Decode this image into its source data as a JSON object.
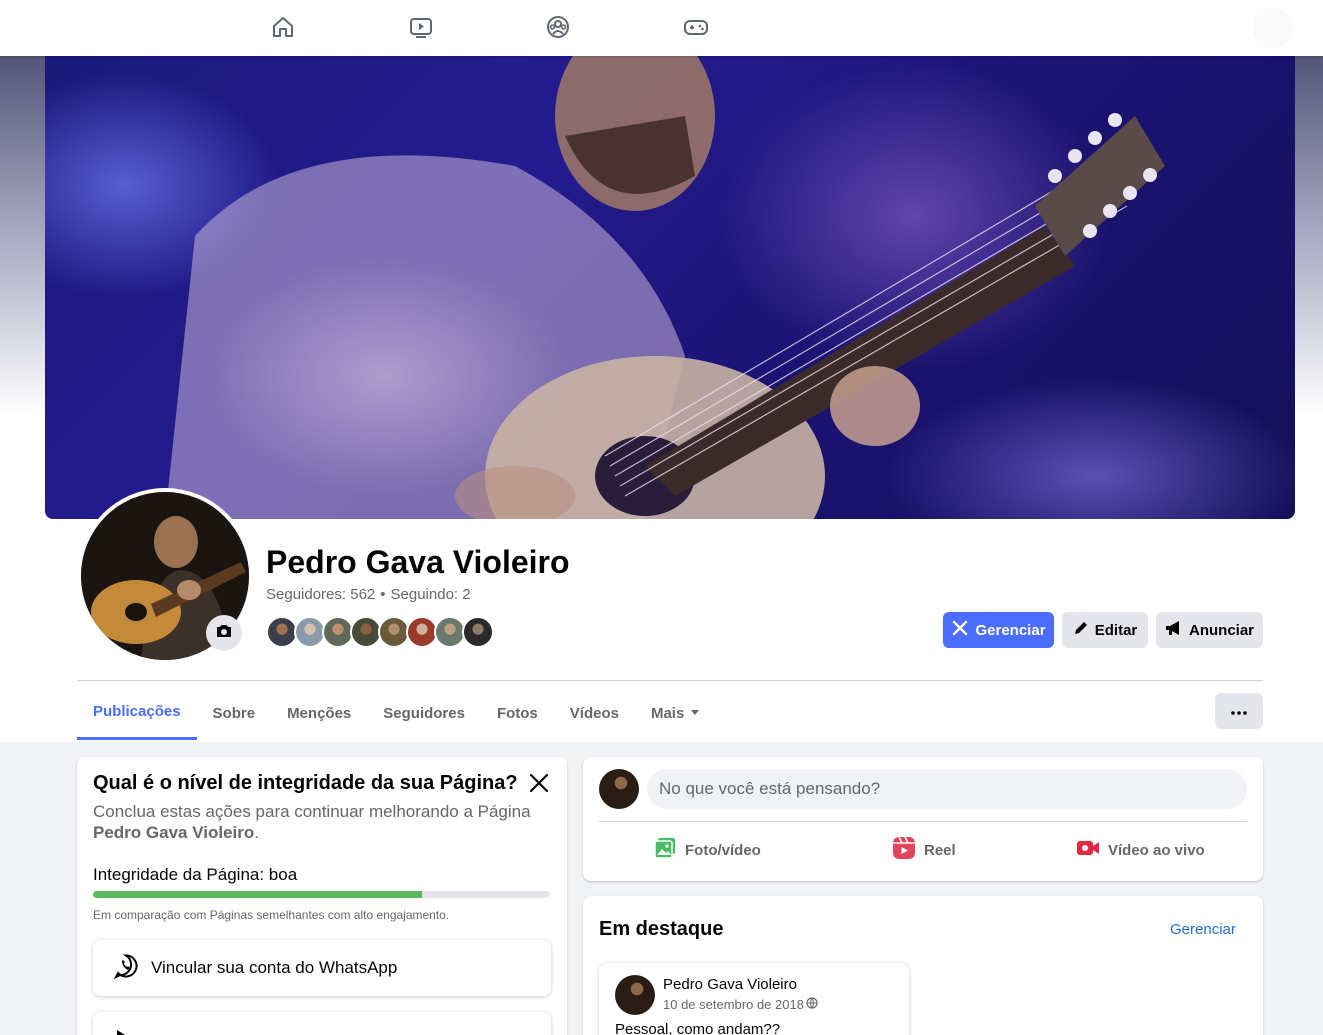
{
  "nav": {
    "icons": [
      "home-icon",
      "watch-icon",
      "groups-icon",
      "gaming-icon"
    ]
  },
  "profile": {
    "name": "Pedro Gava Violeiro",
    "followers_text": "Seguidores: 562",
    "separator": "•",
    "following_text": "Seguindo: 2",
    "follower_avatar_count": 8
  },
  "actions": {
    "manage": "Gerenciar",
    "edit": "Editar",
    "advertise": "Anunciar"
  },
  "tabs": {
    "posts": "Publicações",
    "about": "Sobre",
    "mentions": "Menções",
    "followers": "Seguidores",
    "photos": "Fotos",
    "videos": "Vídeos",
    "more": "Mais"
  },
  "integrity": {
    "title": "Qual é o nível de integridade da sua Página?",
    "desc_prefix": "Conclua estas ações para continuar melhorando a Página",
    "desc_page": "Pedro Gava Violeiro",
    "desc_suffix": ".",
    "level": "Integridade da Página: boa",
    "level_fraction": 0.72,
    "note": "Em comparação com Páginas semelhantes com alto engajamento.",
    "task_1": "Vincular sua conta do WhatsApp"
  },
  "composer": {
    "placeholder": "No que você está pensando?",
    "photo_video": "Foto/vídeo",
    "reel": "Reel",
    "live_video": "Vídeo ao vivo"
  },
  "featured": {
    "title": "Em destaque",
    "manage": "Gerenciar",
    "post_author": "Pedro Gava Violeiro",
    "post_date": "10 de setembro de 2018",
    "post_text": "Pessoal, como andam??"
  }
}
